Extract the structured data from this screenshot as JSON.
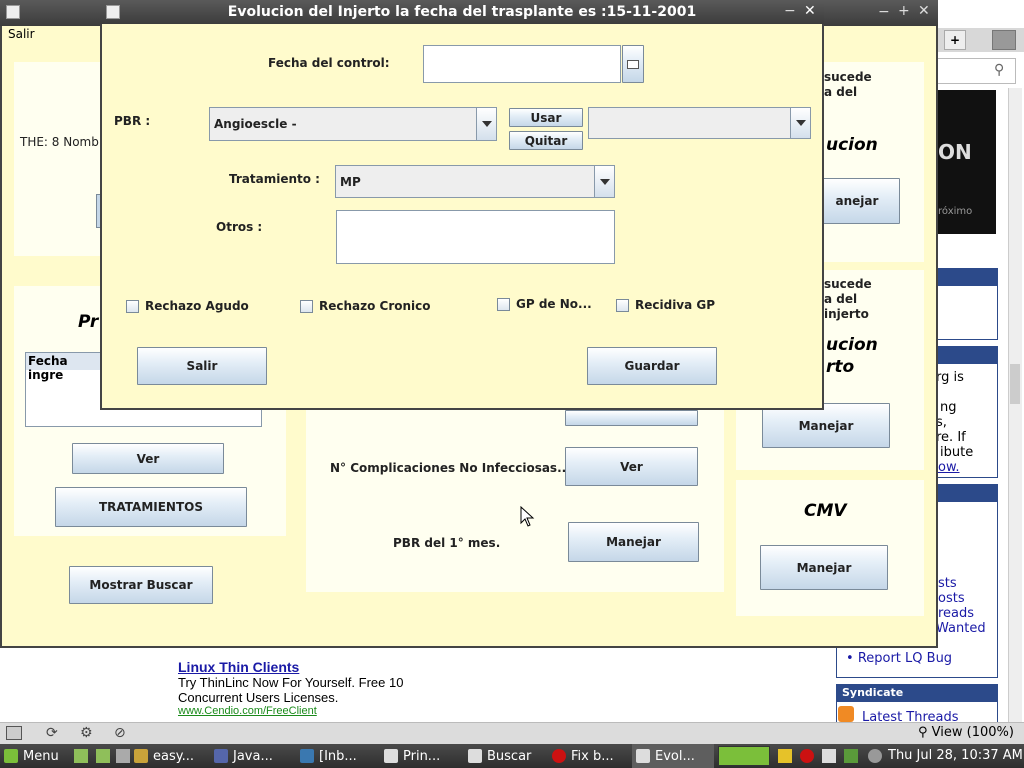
{
  "dialog": {
    "title": "Evolucion del Injerto la fecha del trasplante es :15-11-2001",
    "fecha_control_label": "Fecha del control:",
    "fecha_control_value": "",
    "pbr_label": "PBR :",
    "pbr_value": "Angioescle -",
    "usar_label": "Usar",
    "quitar_label": "Quitar",
    "pbr_extra_value": "",
    "tratamiento_label": "Tratamiento :",
    "tratamiento_value": "MP",
    "otros_label": "Otros :",
    "otros_value": "",
    "checkboxes": [
      "Rechazo Agudo",
      "Rechazo Cronico",
      "GP de No...",
      "Recidiva GP"
    ],
    "salir_label": "Salir",
    "guardar_label": "Guardar"
  },
  "main_window": {
    "menu_salir": "Salir",
    "the_text": "THE: 8 Nomb",
    "pr_heading": "Pr",
    "table_header": "Fecha ingre",
    "ver_left": "Ver",
    "tratamientos": "TRATAMIENTOS",
    "mostrar_buscar": "Mostrar Buscar",
    "complicaciones_label": "N° Complicaciones No Infecciosas...",
    "ver_center": "Ver",
    "pbr_mes_label": "PBR del 1° mes.",
    "manejar_center": "Manejar",
    "sucede_1": "sucede",
    "sucede_1b": "a del",
    "evolucion_1": "ucion",
    "manejar_right_1": "anejar",
    "sucede_2": "sucede",
    "sucede_2b": "a del",
    "sucede_2c": "injerto",
    "evolucion_2": "ucion",
    "evolucion_2b": "rto",
    "manejar_right_2": "Manejar",
    "cmv": "CMV",
    "manejar_cmv": "Manejar"
  },
  "browser": {
    "ad_title": "Linux Thin Clients",
    "ad_line1": "Try ThinLinc Now For Yourself. Free 10",
    "ad_line2": "Concurrent Users Licenses.",
    "ad_url": "www.Cendio.com/FreeClient",
    "side_on": "ON",
    "side_proximo": "róximo",
    "side_text": [
      "rg is",
      "ng",
      "s,",
      "re. If",
      "ibute",
      "ow."
    ],
    "side_links": [
      "sts",
      "osts",
      "reads",
      "Wanted"
    ],
    "report_bug": "Report LQ Bug",
    "syndicate": "Syndicate",
    "latest_threads": "Latest Threads",
    "zoom": "View (100%)"
  },
  "taskbar": {
    "menu": "Menu",
    "items": [
      "easy...",
      "Java...",
      "[Inb...",
      "Prin...",
      "Buscar",
      "Fix b...",
      "Evol..."
    ],
    "clock": "Thu Jul 28, 10:37 AM"
  },
  "colors": {
    "title_bar": "#4a4a4a",
    "panel_bg": "#fffff0",
    "window_bg": "#fffbcc",
    "taskbar_bg": "#3c3c3c",
    "link_blue": "#1a1aa6",
    "sidebar_header": "#2c4a8a"
  }
}
